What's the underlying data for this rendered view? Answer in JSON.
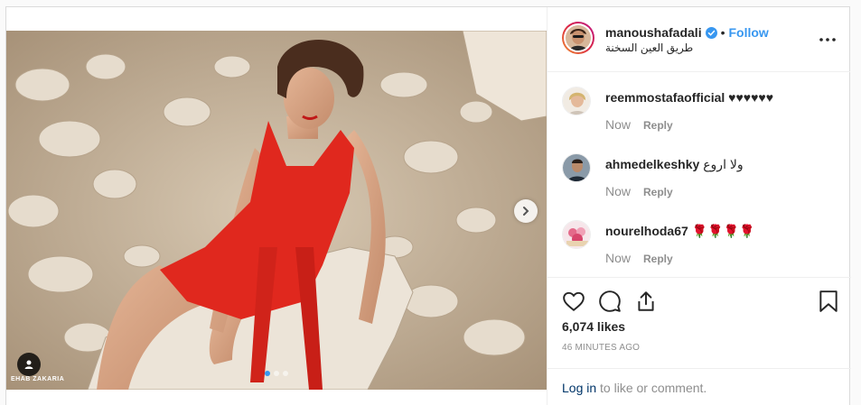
{
  "post": {
    "username": "manoushafadali",
    "follow_label": "Follow",
    "separator": "•",
    "location": "طريق العين السخنة",
    "more_label": "•••",
    "watermark": "EHAB ZAKARIA"
  },
  "comments": [
    {
      "username": "reemmostafaofficial",
      "text": "♥♥♥♥♥♥",
      "time": "Now",
      "reply_label": "Reply"
    },
    {
      "username": "ahmedelkeshky",
      "text": "ولا اروع",
      "time": "Now",
      "reply_label": "Reply"
    },
    {
      "username": "nourelhoda67",
      "text": "🌹🌹🌹🌹",
      "time": "Now",
      "reply_label": "Reply"
    }
  ],
  "actions": {
    "like_icon": "heart-icon",
    "comment_icon": "comment-icon",
    "share_icon": "share-icon",
    "save_icon": "bookmark-icon",
    "likes": "6,074 likes",
    "timestamp": "46 MINUTES AGO"
  },
  "login": {
    "link": "Log in",
    "text": " to like or comment."
  },
  "colors": {
    "link_blue": "#3897f0",
    "dress_red": "#e0281e",
    "muted": "#8e8e8e"
  }
}
